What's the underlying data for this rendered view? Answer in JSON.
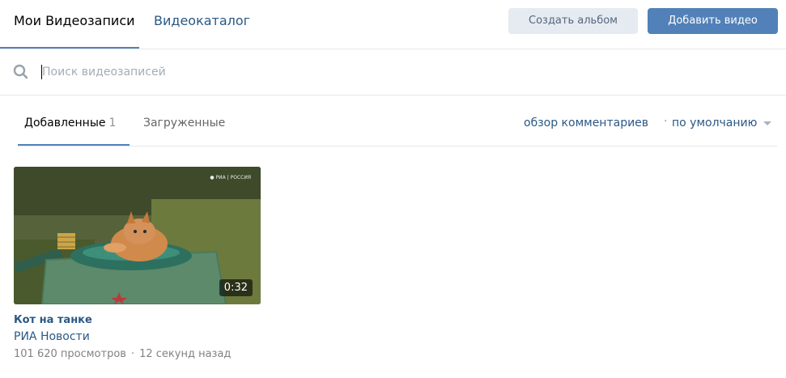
{
  "header": {
    "tabs": [
      {
        "label": "Мои Видеозаписи",
        "active": true
      },
      {
        "label": "Видеокаталог",
        "active": false
      }
    ],
    "create_album_label": "Создать альбом",
    "add_video_label": "Добавить видео"
  },
  "search": {
    "placeholder": "Поиск видеозаписей",
    "value": ""
  },
  "subtabs": {
    "added_label": "Добавленные",
    "added_count": "1",
    "uploaded_label": "Загруженные",
    "comments_link": "обзор комментариев",
    "separator": "·",
    "sort_label": "по умолчанию"
  },
  "videos": [
    {
      "title": "Кот на танке",
      "author": "РИА Новости",
      "views": "101 620 просмотров",
      "separator": "·",
      "time_ago": "12 секунд назад",
      "duration": "0:32",
      "thumbnail_icon": "cat-on-tank-thumbnail"
    }
  ],
  "colors": {
    "accent": "#5181b8",
    "link": "#2a5885",
    "muted": "#828282",
    "secondary_button_bg": "#e5ebf1"
  }
}
